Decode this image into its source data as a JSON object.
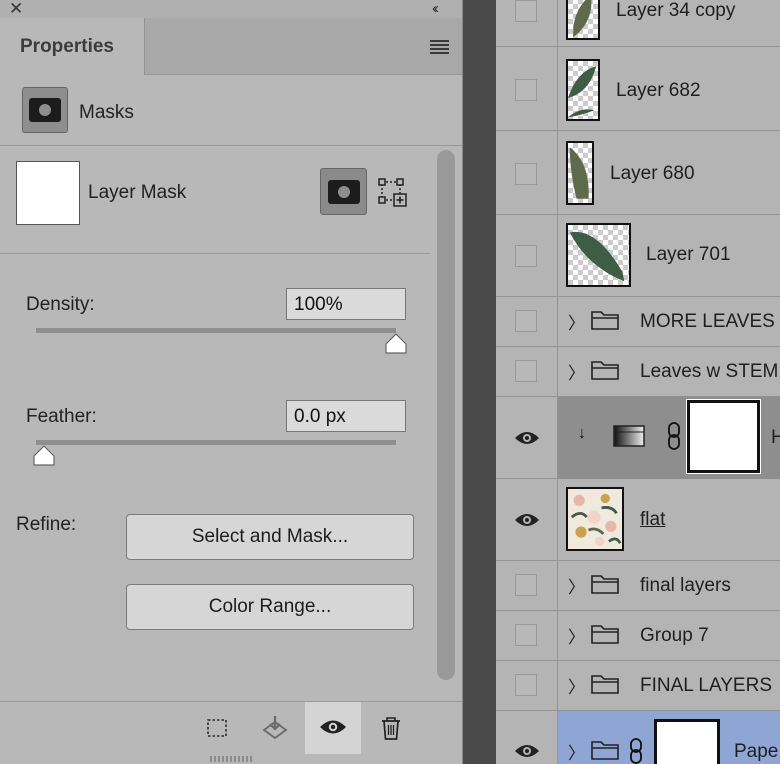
{
  "properties_panel": {
    "tab_title": "Properties",
    "section_title": "Masks",
    "layer_mask_label": "Layer Mask",
    "density": {
      "label": "Density:",
      "value": "100%",
      "slider_fraction": 1.0
    },
    "feather": {
      "label": "Feather:",
      "value": "0.0 px",
      "slider_fraction": 0.0
    },
    "refine": {
      "label": "Refine:",
      "select_and_mask": "Select and Mask...",
      "color_range": "Color Range..."
    },
    "icons": {
      "close": "close-icon",
      "collapse": "double-chevron-left-icon",
      "menu": "hamburger-menu-icon",
      "pixel_mask": "pixel-mask-icon",
      "vector_mask": "vector-mask-icon",
      "load_selection": "load-selection-icon",
      "apply_mask": "apply-mask-icon",
      "toggle_visibility": "eye-icon",
      "delete": "trash-icon"
    }
  },
  "layers_panel": {
    "rows": [
      {
        "name": "Layer 34 copy",
        "kind": "layer",
        "visible": false
      },
      {
        "name": "Layer 682",
        "kind": "layer",
        "visible": false
      },
      {
        "name": "Layer 680",
        "kind": "layer",
        "visible": false
      },
      {
        "name": "Layer 701",
        "kind": "layer",
        "visible": false
      },
      {
        "name": "MORE LEAVES",
        "kind": "group",
        "visible": false
      },
      {
        "name": "Leaves w STEM",
        "kind": "group",
        "visible": false
      },
      {
        "name": "H",
        "kind": "adjustment",
        "visible": true,
        "selected_gray": true
      },
      {
        "name": "flat",
        "kind": "layer",
        "visible": true
      },
      {
        "name": "final layers",
        "kind": "group",
        "visible": false
      },
      {
        "name": "Group 7",
        "kind": "group",
        "visible": false
      },
      {
        "name": "FINAL LAYERS",
        "kind": "group",
        "visible": false
      },
      {
        "name": "Pape",
        "kind": "group",
        "visible": true,
        "selected": true
      }
    ]
  },
  "colors": {
    "panel_bg": "#b8b8b8",
    "gap": "#4a4a4a",
    "selected_row": "#8fa5d4",
    "adjustment_row": "#8e8e8e",
    "leaf_green": "#3f5c45",
    "leaf_olive": "#5f6a4c"
  }
}
